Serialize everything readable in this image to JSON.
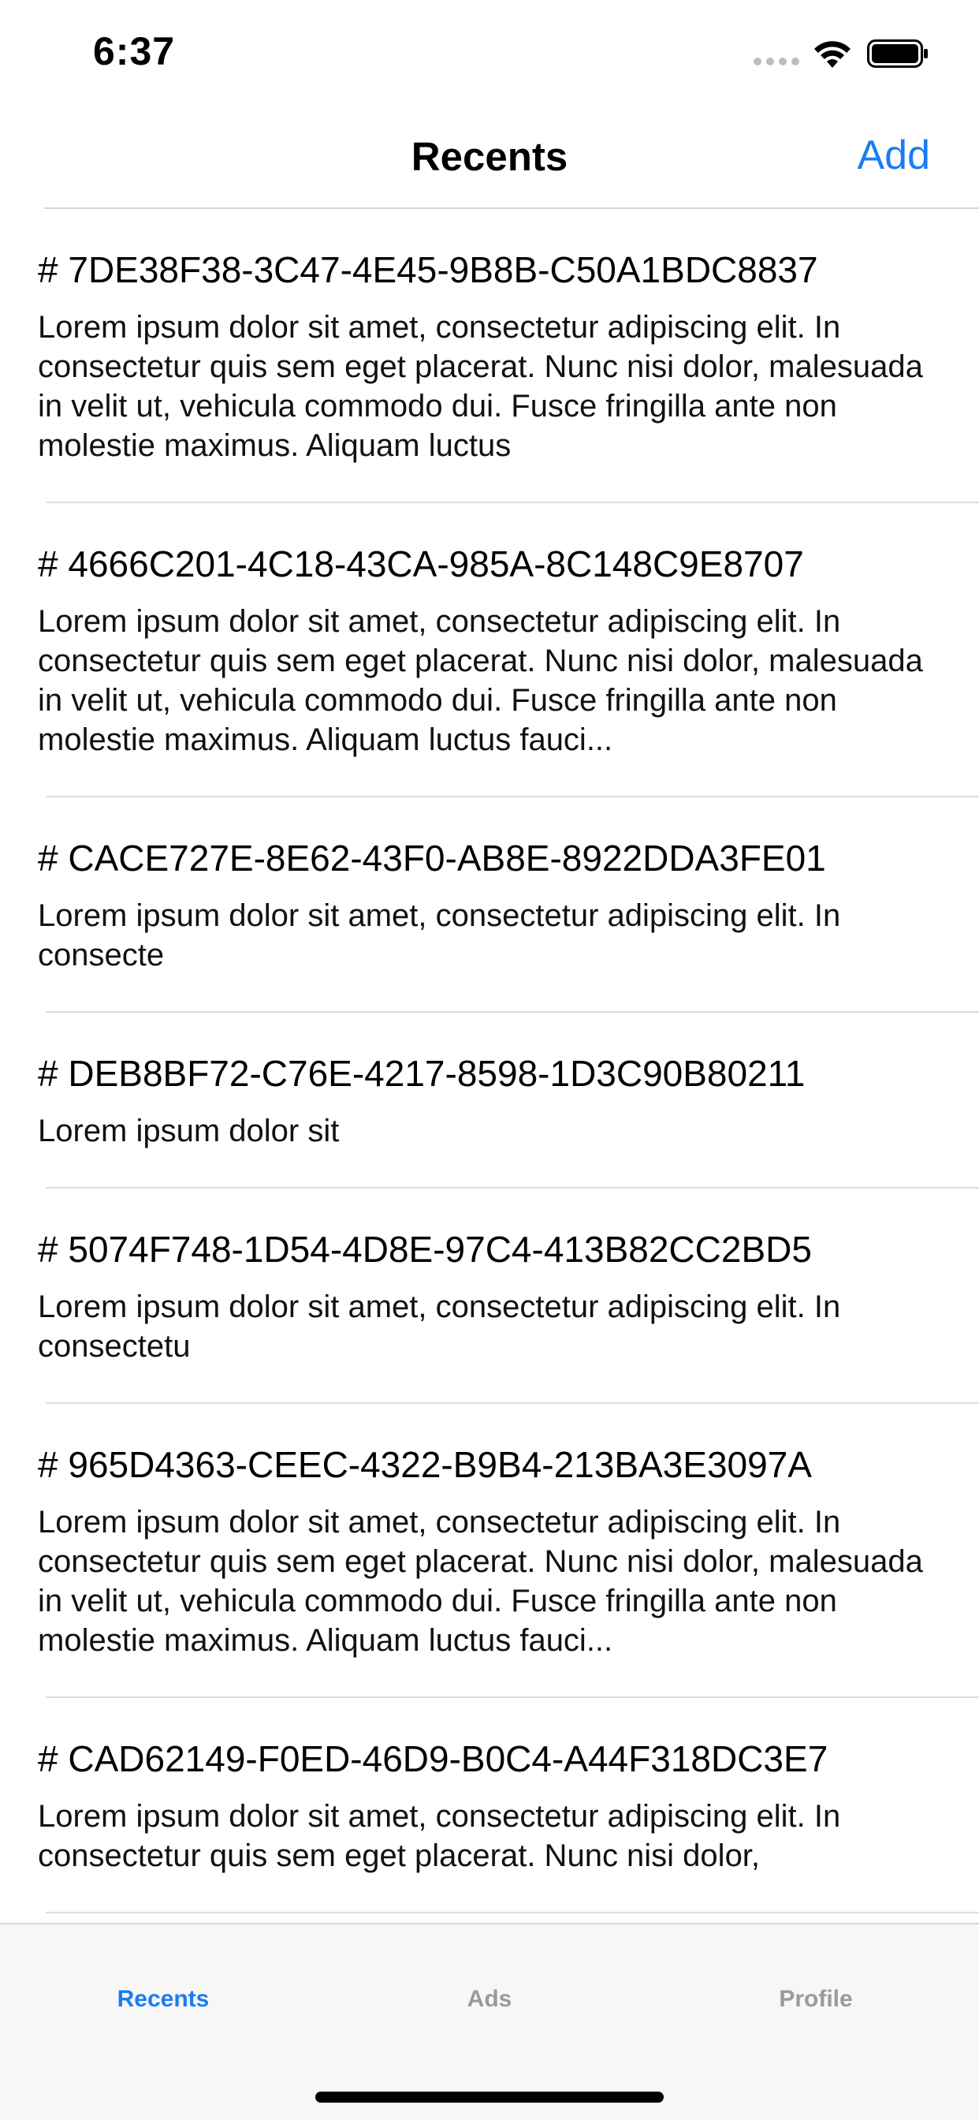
{
  "status_bar": {
    "time": "6:37",
    "icons": [
      "signal-dots-icon",
      "wifi-icon",
      "battery-icon"
    ]
  },
  "nav": {
    "title": "Recents",
    "add_label": "Add"
  },
  "items": [
    {
      "title": "# 7DE38F38-3C47-4E45-9B8B-C50A1BDC8837",
      "body": "Lorem ipsum dolor sit amet, consectetur adipiscing elit. In consectetur quis sem eget placerat. Nunc nisi dolor, malesuada in velit ut, vehicula commodo dui. Fusce fringilla ante non molestie maximus. Aliquam luctus"
    },
    {
      "title": "# 4666C201-4C18-43CA-985A-8C148C9E8707",
      "body": "Lorem ipsum dolor sit amet, consectetur adipiscing elit. In consectetur quis sem eget placerat. Nunc nisi dolor, malesuada in velit ut, vehicula commodo dui. Fusce fringilla ante non molestie maximus. Aliquam luctus fauci..."
    },
    {
      "title": "# CACE727E-8E62-43F0-AB8E-8922DDA3FE01",
      "body": "Lorem ipsum dolor sit amet, consectetur adipiscing elit. In consecte"
    },
    {
      "title": "# DEB8BF72-C76E-4217-8598-1D3C90B80211",
      "body": "Lorem ipsum dolor sit"
    },
    {
      "title": "# 5074F748-1D54-4D8E-97C4-413B82CC2BD5",
      "body": "Lorem ipsum dolor sit amet, consectetur adipiscing elit. In consectetu"
    },
    {
      "title": "# 965D4363-CEEC-4322-B9B4-213BA3E3097A",
      "body": "Lorem ipsum dolor sit amet, consectetur adipiscing elit. In consectetur quis sem eget placerat. Nunc nisi dolor, malesuada in velit ut, vehicula commodo dui. Fusce fringilla ante non molestie maximus. Aliquam luctus fauci..."
    },
    {
      "title": "# CAD62149-F0ED-46D9-B0C4-A44F318DC3E7",
      "body": "Lorem ipsum dolor sit amet, consectetur adipiscing elit. In consectetur quis sem eget placerat. Nunc nisi dolor,"
    }
  ],
  "tabs": [
    {
      "label": "Recents",
      "active": true
    },
    {
      "label": "Ads",
      "active": false
    },
    {
      "label": "Profile",
      "active": false
    }
  ],
  "colors": {
    "accent": "#1a7cf5",
    "inactive_tab": "#9a9a9e",
    "tab_bar_bg": "#f7f7f7",
    "separator": "#dcdcde"
  }
}
